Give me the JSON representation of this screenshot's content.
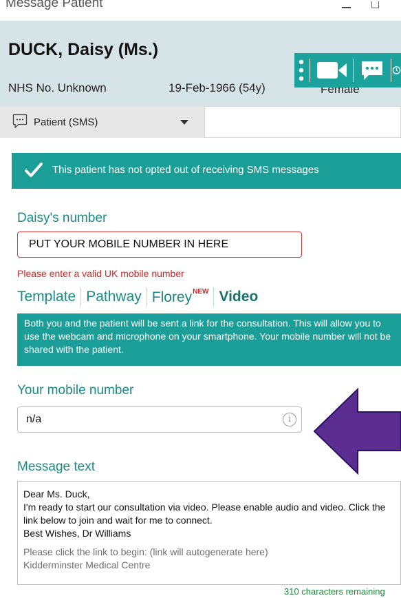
{
  "window": {
    "title": "Message Patient",
    "minimize_icon": "minimize-icon",
    "maximize_icon": "maximize-icon"
  },
  "patient": {
    "name": "DUCK, Daisy (Ms.)",
    "nhs": "NHS No. Unknown",
    "dob": "19-Feb-1966 (54y)",
    "sex": "Female"
  },
  "toolbar": {
    "icons": [
      "more-vertical-icon",
      "video-camera-icon",
      "chat-icon",
      "clock-icon"
    ]
  },
  "recipient": {
    "selected": "Patient (SMS)",
    "icon": "sms-icon"
  },
  "optin_banner": {
    "text": "This patient has not opted out of receiving SMS messages",
    "icon": "checkmark-icon"
  },
  "patient_number": {
    "label": "Daisy's number",
    "value": "PUT YOUR MOBILE NUMBER IN HERE",
    "error": "Please enter a valid UK mobile number"
  },
  "tabs": [
    {
      "label": "Template"
    },
    {
      "label": "Pathway"
    },
    {
      "label": "Florey",
      "badge": "NEW"
    },
    {
      "label": "Video",
      "active": true
    }
  ],
  "video_info": {
    "text": "Both you and the patient will be sent a link for the consultation. This will allow you to use the webcam and microphone on your smartphone. Your mobile number will not be shared with the patient."
  },
  "your_mobile": {
    "label": "Your mobile number",
    "value": "n/a",
    "info_icon": "info-icon",
    "info_glyph": "i"
  },
  "message": {
    "label": "Message text",
    "lines": [
      "Dear Ms. Duck,",
      "I'm ready to start our consultation via video. Please enable audio and video. Click the link below to join and wait for me to connect.",
      "Best Wishes, Dr Williams"
    ],
    "autogen_lines": [
      "Please click the link to begin: (link will autogenerate here)",
      "Kidderminster Medical Centre"
    ],
    "remaining": "310 characters remaining"
  },
  "colors": {
    "accent": "#1b9e98",
    "header_bg": "#d7e4e7",
    "error": "#e02020",
    "arrow": "#5b2d91"
  }
}
